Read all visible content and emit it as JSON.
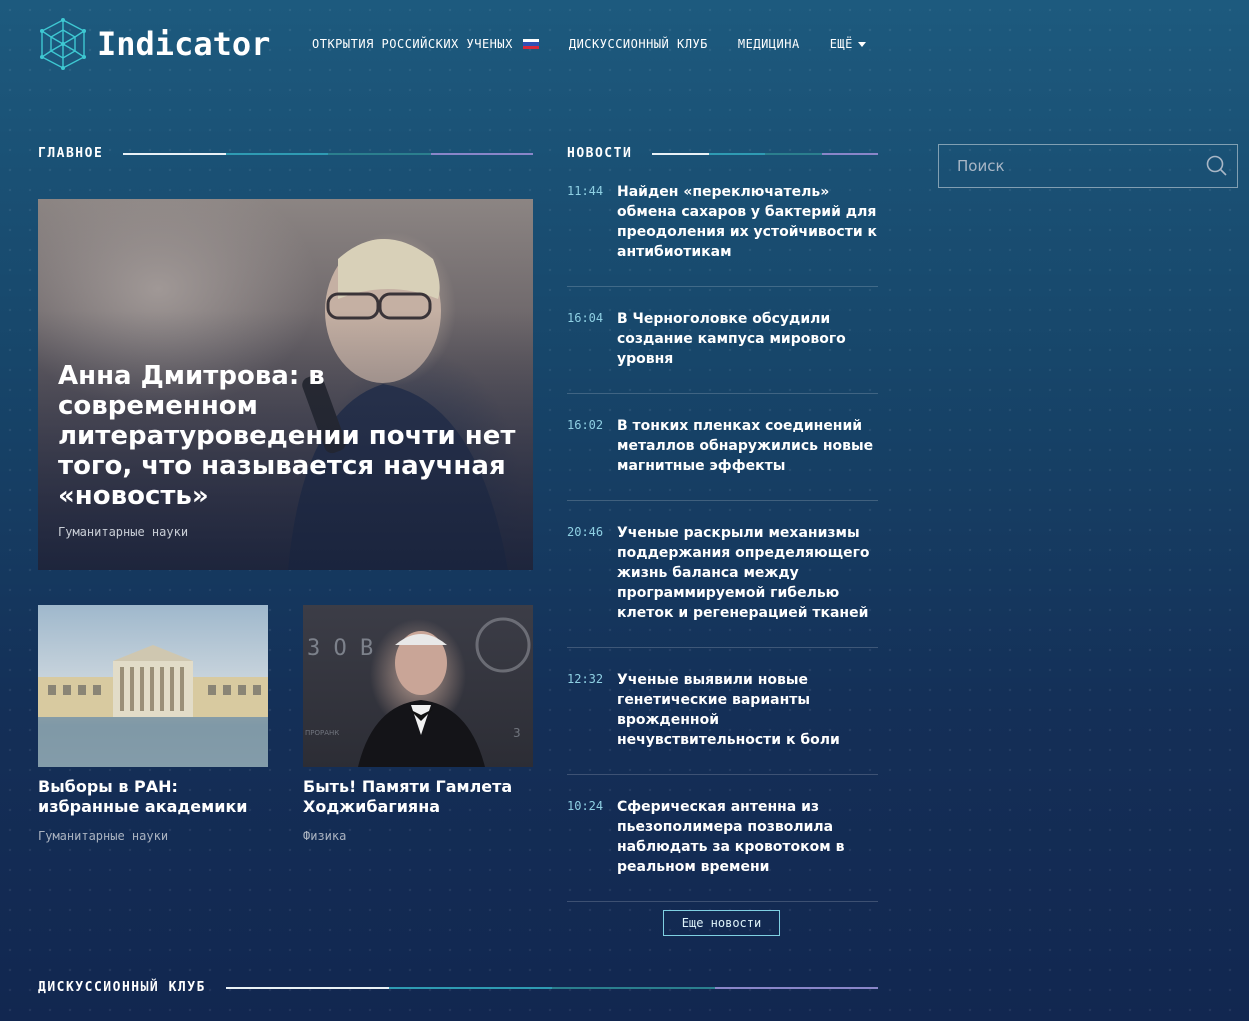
{
  "header": {
    "logo_text": "Indicator",
    "nav": [
      {
        "label": "ОТКРЫТИЯ РОССИЙСКИХ УЧЕНЫХ"
      },
      {
        "label": "ДИСКУССИОННЫЙ КЛУБ"
      },
      {
        "label": "МЕДИЦИНА"
      },
      {
        "label": "ЕЩЁ"
      }
    ],
    "flag_colors": [
      "#ffffff",
      "#2f4fb5",
      "#d8283a"
    ]
  },
  "main": {
    "section_title": "ГЛАВНОЕ",
    "featured": {
      "title": "Анна Дмитрова: в современном литературоведении почти нет того, что называется научная «новость»",
      "rubric": "Гуманитарные науки"
    },
    "cards": [
      {
        "title": "Выборы в РАН: избранные академики",
        "rubric": "Гуманитарные науки"
      },
      {
        "title": "Быть! Памяти Гамлета Ходжибагияна",
        "rubric": "Физика"
      }
    ]
  },
  "news": {
    "section_title": "НОВОСТИ",
    "items": [
      {
        "time": "11:44",
        "text": "Найден «переключатель» обмена сахаров у бактерий для преодоления их устойчивости к антибиотикам"
      },
      {
        "time": "16:04",
        "text": "В Черноголовке обсудили создание кампуса мирового уровня"
      },
      {
        "time": "16:02",
        "text": "В тонких пленках соединений металлов обнаружились новые магнитные эффекты"
      },
      {
        "time": "20:46",
        "text": "Ученые раскрыли механизмы поддержания определяющего жизнь баланса между программируемой гибелью клеток и регенерацией тканей"
      },
      {
        "time": "12:32",
        "text": "Ученые выявили новые генетические варианты врожденной нечувствительности к боли"
      },
      {
        "time": "10:24",
        "text": "Сферическая антенна из пьезополимера позволила наблюдать за кровотоком в реальном времени"
      }
    ],
    "more_label": "Еще новости"
  },
  "search": {
    "placeholder": "Поиск"
  },
  "club": {
    "section_title": "ДИСКУССИОННЫЙ КЛУБ"
  },
  "photo_texts": {
    "logo_wall": "З О В",
    "banner": "ПРОРАНК",
    "corner": "3"
  },
  "colors": {
    "accent_line": [
      "#e9f1f6",
      "#2f9bb3",
      "#2b7f8e",
      "#8a86c9"
    ],
    "time": "#8fd0e3"
  }
}
